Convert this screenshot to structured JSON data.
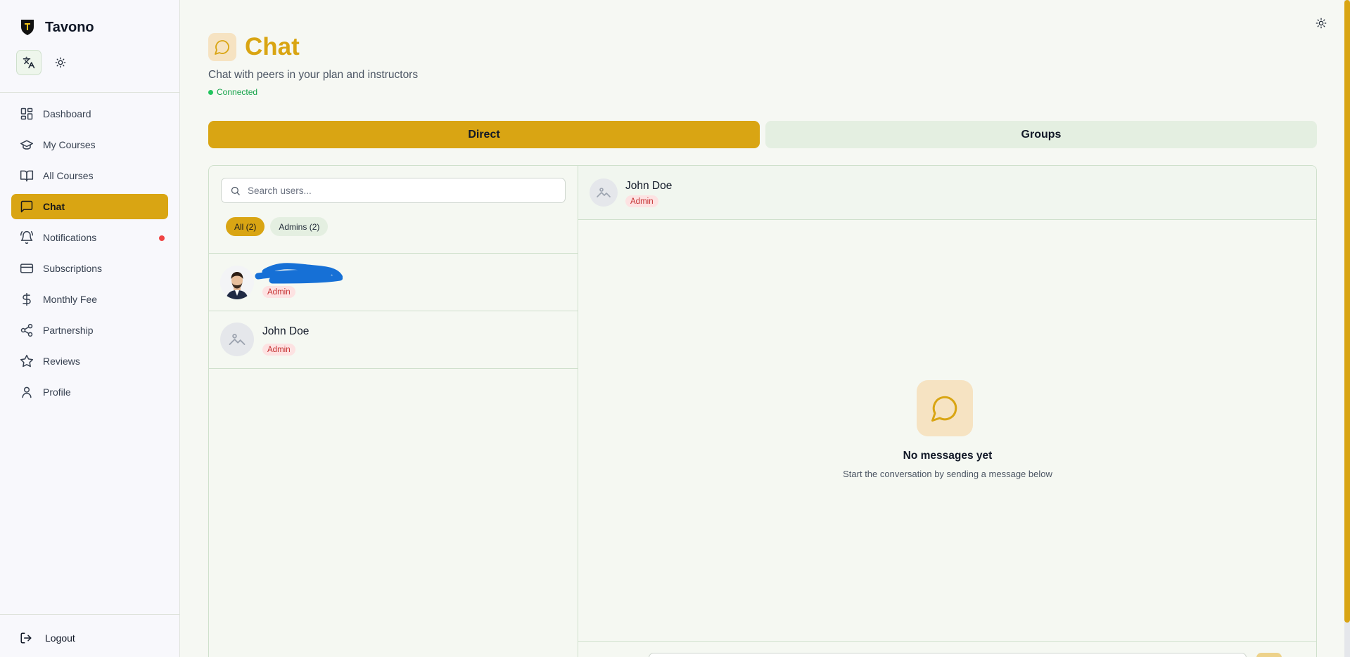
{
  "brand": {
    "name": "Tavono",
    "logo_icon": "tavono-logo-icon"
  },
  "sidebar": {
    "items": [
      {
        "label": "Dashboard",
        "icon": "dashboard-icon"
      },
      {
        "label": "My Courses",
        "icon": "graduation-cap-icon"
      },
      {
        "label": "All Courses",
        "icon": "book-open-icon"
      },
      {
        "label": "Chat",
        "icon": "chat-bubble-icon",
        "active": true
      },
      {
        "label": "Notifications",
        "icon": "bell-icon",
        "has_dot": true
      },
      {
        "label": "Subscriptions",
        "icon": "credit-card-icon"
      },
      {
        "label": "Monthly Fee",
        "icon": "dollar-icon"
      },
      {
        "label": "Partnership",
        "icon": "share-icon"
      },
      {
        "label": "Reviews",
        "icon": "star-icon"
      },
      {
        "label": "Profile",
        "icon": "user-icon"
      }
    ],
    "logout_label": "Logout"
  },
  "header": {
    "title": "Chat",
    "subtitle": "Chat with peers in your plan and instructors",
    "status": "Connected"
  },
  "tabs": {
    "direct": "Direct",
    "groups": "Groups"
  },
  "user_list": {
    "search_placeholder": "Search users...",
    "filters": {
      "all": "All (2)",
      "admins": "Admins (2)"
    },
    "users": [
      {
        "name": "",
        "role": "Admin",
        "avatar": "photo"
      },
      {
        "name": "John Doe",
        "role": "Admin",
        "avatar": "placeholder"
      }
    ]
  },
  "conversation": {
    "name": "John Doe",
    "role": "Admin",
    "empty_title": "No messages yet",
    "empty_subtitle": "Start the conversation by sending a message below"
  },
  "colors": {
    "accent": "#d9a513",
    "badge_bg": "#fde2e2",
    "badge_text": "#c53030",
    "status": "#16a34a"
  }
}
